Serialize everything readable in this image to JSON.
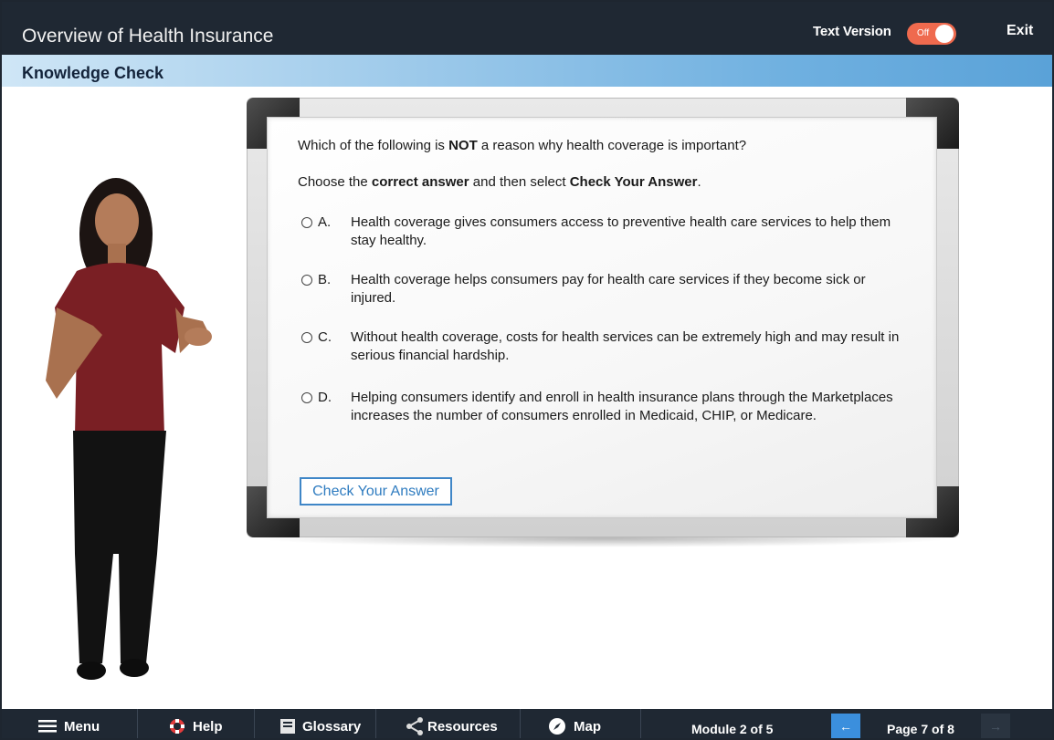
{
  "header": {
    "course_title": "Overview of Health Insurance",
    "text_version_label": "Text Version",
    "text_version_toggle": {
      "state_label": "Off",
      "accent_color": "#ef6a4e"
    },
    "exit_label": "Exit"
  },
  "section": {
    "title": "Knowledge Check"
  },
  "question": {
    "prompt_before": "Which of the following is ",
    "prompt_emphasis": "NOT",
    "prompt_after": " a reason why health coverage is important?",
    "instruction_before": "Choose the ",
    "instruction_emphasis_1": "correct answer",
    "instruction_middle": " and then select ",
    "instruction_emphasis_2": "Check Your Answer",
    "instruction_after": "."
  },
  "options": [
    {
      "letter": "A.",
      "text": "Health coverage gives consumers access to preventive health care services to help them stay healthy."
    },
    {
      "letter": "B.",
      "text": "Health coverage helps consumers pay for health care services if they become sick or injured."
    },
    {
      "letter": "C.",
      "text": "Without health coverage, costs for health services can be extremely high and may result in serious financial hardship."
    },
    {
      "letter": "D.",
      "text": "Helping consumers identify and enroll in health insurance plans through the Marketplaces increases the number of consumers enrolled in Medicaid, CHIP, or Medicare."
    }
  ],
  "check_button_label": "Check Your Answer",
  "footer": {
    "menu_label": "Menu",
    "help_label": "Help",
    "glossary_label": "Glossary",
    "resources_label": "Resources",
    "map_label": "Map",
    "module_status": "Module 2 of 5",
    "page_status": "Page 7 of 8",
    "prev_icon": "left-arrow-icon",
    "next_icon": "right-arrow-icon"
  },
  "colors": {
    "header_bg": "#1f2833",
    "section_gradient_end": "#5aa2d8",
    "button_blue": "#3f86c7",
    "prev_button": "#3b8fdd"
  }
}
